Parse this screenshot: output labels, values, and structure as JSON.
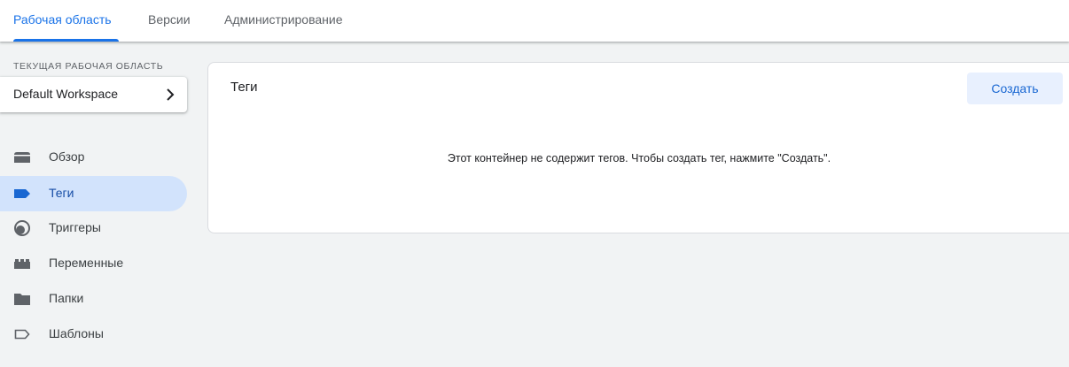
{
  "tabs": [
    {
      "label": "Рабочая область",
      "active": true
    },
    {
      "label": "Версии",
      "active": false
    },
    {
      "label": "Администрирование",
      "active": false
    }
  ],
  "sidebar": {
    "caption": "ТЕКУЩАЯ РАБОЧАЯ ОБЛАСТЬ",
    "workspace_name": "Default Workspace",
    "items": [
      {
        "label": "Обзор",
        "icon": "overview-icon",
        "active": false
      },
      {
        "label": "Теги",
        "icon": "tag-icon",
        "active": true
      },
      {
        "label": "Триггеры",
        "icon": "trigger-icon",
        "active": false
      },
      {
        "label": "Переменные",
        "icon": "variables-icon",
        "active": false
      },
      {
        "label": "Папки",
        "icon": "folder-icon",
        "active": false
      },
      {
        "label": "Шаблоны",
        "icon": "template-icon",
        "active": false
      }
    ]
  },
  "panel": {
    "title": "Теги",
    "create_label": "Создать",
    "empty_message": "Этот контейнер не содержит тегов. Чтобы создать тег, нажмите \"Создать\"."
  },
  "colors": {
    "accent": "#1a73e8",
    "active_nav_bg": "#d2e3fc",
    "button_bg": "#e8f0fe",
    "page_bg": "#f1f3f4"
  }
}
